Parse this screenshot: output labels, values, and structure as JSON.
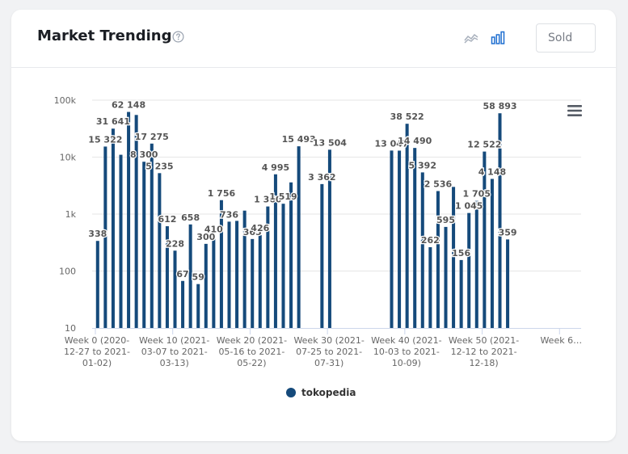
{
  "header": {
    "title": "Market Trending",
    "metric_selected": "Sold"
  },
  "icons": {
    "help": "help-circle-icon",
    "line_chart": "line-chart-icon",
    "bar_chart": "bar-chart-icon",
    "menu": "hamburger-menu-icon"
  },
  "colors": {
    "series": "#154a7b",
    "accent": "#1f6fd0",
    "muted": "#9aa3b0"
  },
  "chart_data": {
    "type": "bar",
    "y_scale": "log",
    "ylim": [
      10,
      100000
    ],
    "y_ticks": [
      {
        "v": 10,
        "label": "10"
      },
      {
        "v": 100,
        "label": "100"
      },
      {
        "v": 1000,
        "label": "1k"
      },
      {
        "v": 10000,
        "label": "10k"
      },
      {
        "v": 100000,
        "label": "100k"
      }
    ],
    "x_ticks": [
      {
        "i": 0,
        "lines": [
          "Week 0 (2020-",
          "12-27 to 2021-",
          "01-02)"
        ]
      },
      {
        "i": 10,
        "lines": [
          "Week 10 (2021-",
          "03-07 to 2021-",
          "03-13)"
        ]
      },
      {
        "i": 20,
        "lines": [
          "Week 20 (2021-",
          "05-16 to 2021-",
          "05-22)"
        ]
      },
      {
        "i": 30,
        "lines": [
          "Week 30 (2021-",
          "07-25 to 2021-",
          "07-31)"
        ]
      },
      {
        "i": 40,
        "lines": [
          "Week 40 (2021-",
          "10-03 to 2021-",
          "10-09)"
        ]
      },
      {
        "i": 50,
        "lines": [
          "Week 50 (2021-",
          "12-12 to 2021-",
          "12-18)"
        ]
      },
      {
        "i": 60,
        "lines": [
          "Week 6…"
        ]
      }
    ],
    "n_categories": 63,
    "legend": [
      "tokopedia"
    ],
    "series": [
      {
        "name": "tokopedia",
        "values": [
          338,
          15322,
          31641,
          11000,
          62148,
          55000,
          8300,
          17275,
          5235,
          612,
          228,
          67,
          658,
          59,
          300,
          410,
          1756,
          736,
          760,
          1150,
          365,
          426,
          1360,
          4995,
          1519,
          3600,
          15493,
          null,
          null,
          3362,
          13504,
          null,
          null,
          null,
          null,
          null,
          null,
          null,
          13047,
          13000,
          38522,
          14490,
          5392,
          262,
          2536,
          595,
          3000,
          156,
          1045,
          1705,
          12522,
          4148,
          58893,
          359,
          null,
          null,
          null,
          null,
          null,
          null,
          null,
          null,
          null
        ],
        "labels": [
          {
            "i": 0,
            "text": "338"
          },
          {
            "i": 1,
            "text": "15 322"
          },
          {
            "i": 2,
            "text": "31 641"
          },
          {
            "i": 4,
            "text": "62 148"
          },
          {
            "i": 6,
            "text": "8 300"
          },
          {
            "i": 7,
            "text": "17 275"
          },
          {
            "i": 8,
            "text": "5 235"
          },
          {
            "i": 9,
            "text": "612"
          },
          {
            "i": 10,
            "text": "228"
          },
          {
            "i": 11,
            "text": "67"
          },
          {
            "i": 12,
            "text": "658"
          },
          {
            "i": 13,
            "text": "59"
          },
          {
            "i": 14,
            "text": "300"
          },
          {
            "i": 15,
            "text": "410"
          },
          {
            "i": 16,
            "text": "1 756"
          },
          {
            "i": 17,
            "text": "736"
          },
          {
            "i": 20,
            "text": "365"
          },
          {
            "i": 21,
            "text": "426"
          },
          {
            "i": 22,
            "text": "1 360"
          },
          {
            "i": 23,
            "text": "4 995"
          },
          {
            "i": 24,
            "text": "1 519"
          },
          {
            "i": 26,
            "text": "15 493"
          },
          {
            "i": 29,
            "text": "3 362"
          },
          {
            "i": 30,
            "text": "13 504"
          },
          {
            "i": 38,
            "text": "13 047"
          },
          {
            "i": 40,
            "text": "38 522"
          },
          {
            "i": 41,
            "text": "14 490"
          },
          {
            "i": 42,
            "text": "5 392"
          },
          {
            "i": 43,
            "text": "262"
          },
          {
            "i": 44,
            "text": "2 536"
          },
          {
            "i": 45,
            "text": "595"
          },
          {
            "i": 47,
            "text": "156"
          },
          {
            "i": 48,
            "text": "1 045"
          },
          {
            "i": 49,
            "text": "1 705"
          },
          {
            "i": 50,
            "text": "12 522"
          },
          {
            "i": 51,
            "text": "4 148"
          },
          {
            "i": 52,
            "text": "58 893"
          },
          {
            "i": 53,
            "text": "359"
          }
        ]
      }
    ]
  }
}
